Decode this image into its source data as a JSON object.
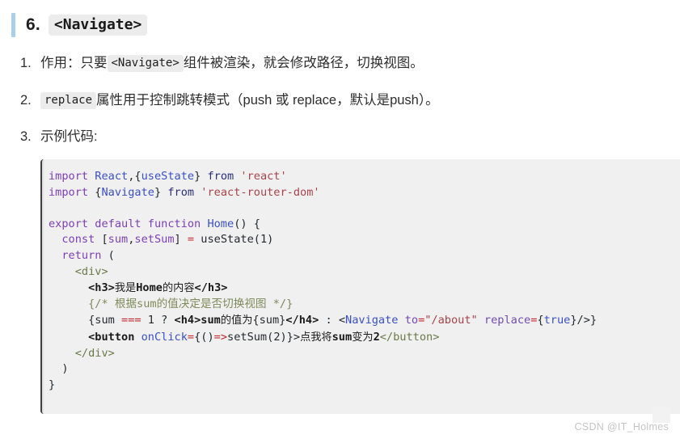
{
  "heading": {
    "number": "6.",
    "code": "<Navigate>"
  },
  "list": [
    {
      "marker": "1.",
      "before": "作用：只要",
      "code": "<Navigate>",
      "after": "组件被渲染，就会修改路径，切换视图。"
    },
    {
      "marker": "2.",
      "before": "",
      "code": "replace",
      "after": "属性用于控制跳转模式（push 或 replace，默认是push）。"
    },
    {
      "marker": "3.",
      "before": "示例代码:",
      "code": "",
      "after": ""
    }
  ],
  "code_block": {
    "language": "jsx",
    "lines": [
      {
        "tokens": [
          {
            "t": "import",
            "c": "tok-kw"
          },
          {
            "t": " ",
            "c": "tok-plain"
          },
          {
            "t": "React",
            "c": "tok-fn"
          },
          {
            "t": ",{",
            "c": "tok-punc"
          },
          {
            "t": "useState",
            "c": "tok-fn"
          },
          {
            "t": "} ",
            "c": "tok-punc"
          },
          {
            "t": "from",
            "c": "tok-from"
          },
          {
            "t": " ",
            "c": "tok-plain"
          },
          {
            "t": "'react'",
            "c": "tok-str"
          }
        ]
      },
      {
        "tokens": [
          {
            "t": "import",
            "c": "tok-kw"
          },
          {
            "t": " {",
            "c": "tok-punc"
          },
          {
            "t": "Navigate",
            "c": "tok-fn"
          },
          {
            "t": "} ",
            "c": "tok-punc"
          },
          {
            "t": "from",
            "c": "tok-from"
          },
          {
            "t": " ",
            "c": "tok-plain"
          },
          {
            "t": "'react-router-dom'",
            "c": "tok-str"
          }
        ]
      },
      {
        "tokens": []
      },
      {
        "tokens": [
          {
            "t": "export default function",
            "c": "tok-kw"
          },
          {
            "t": " ",
            "c": "tok-plain"
          },
          {
            "t": "Home",
            "c": "tok-fn"
          },
          {
            "t": "() {",
            "c": "tok-punc"
          }
        ]
      },
      {
        "tokens": [
          {
            "t": "  ",
            "c": "tok-plain"
          },
          {
            "t": "const",
            "c": "tok-kw"
          },
          {
            "t": " [",
            "c": "tok-punc"
          },
          {
            "t": "sum",
            "c": "tok-var"
          },
          {
            "t": ",",
            "c": "tok-punc"
          },
          {
            "t": "setSum",
            "c": "tok-var"
          },
          {
            "t": "] ",
            "c": "tok-punc"
          },
          {
            "t": "=",
            "c": "tok-op"
          },
          {
            "t": " useState(",
            "c": "tok-plain"
          },
          {
            "t": "1",
            "c": "tok-num"
          },
          {
            "t": ")",
            "c": "tok-punc"
          }
        ]
      },
      {
        "tokens": [
          {
            "t": "  ",
            "c": "tok-plain"
          },
          {
            "t": "return",
            "c": "tok-kw"
          },
          {
            "t": " (",
            "c": "tok-punc"
          }
        ]
      },
      {
        "tokens": [
          {
            "t": "    ",
            "c": "tok-plain"
          },
          {
            "t": "<div>",
            "c": "tok-tag"
          }
        ]
      },
      {
        "tokens": [
          {
            "t": "      ",
            "c": "tok-plain"
          },
          {
            "t": "<h3>",
            "c": "tok-tagname"
          },
          {
            "t": "我是",
            "c": "tok-cn"
          },
          {
            "t": "Home",
            "c": "tok-tagname"
          },
          {
            "t": "的内容",
            "c": "tok-cn"
          },
          {
            "t": "</h3>",
            "c": "tok-tagname"
          }
        ]
      },
      {
        "tokens": [
          {
            "t": "      ",
            "c": "tok-plain"
          },
          {
            "t": "{/* 根据sum的值决定是否切换视图 */}",
            "c": "tok-comment"
          }
        ]
      },
      {
        "tokens": [
          {
            "t": "      ",
            "c": "tok-plain"
          },
          {
            "t": "{",
            "c": "tok-punc"
          },
          {
            "t": "sum",
            "c": "tok-plain"
          },
          {
            "t": " ",
            "c": "tok-plain"
          },
          {
            "t": "===",
            "c": "tok-op"
          },
          {
            "t": " ",
            "c": "tok-plain"
          },
          {
            "t": "1",
            "c": "tok-num"
          },
          {
            "t": " ? ",
            "c": "tok-punc"
          },
          {
            "t": "<h4>",
            "c": "tok-tagname"
          },
          {
            "t": "sum",
            "c": "tok-tagname"
          },
          {
            "t": "的值为",
            "c": "tok-cn"
          },
          {
            "t": "{sum}",
            "c": "tok-punc"
          },
          {
            "t": "</h4>",
            "c": "tok-tagname"
          },
          {
            "t": " : ",
            "c": "tok-punc"
          },
          {
            "t": "<",
            "c": "tok-punc"
          },
          {
            "t": "Navigate",
            "c": "tok-fn"
          },
          {
            "t": " ",
            "c": "tok-plain"
          },
          {
            "t": "to",
            "c": "tok-attr"
          },
          {
            "t": "=",
            "c": "tok-op"
          },
          {
            "t": "\"/about\"",
            "c": "tok-str"
          },
          {
            "t": " ",
            "c": "tok-plain"
          },
          {
            "t": "replace",
            "c": "tok-attr"
          },
          {
            "t": "=",
            "c": "tok-op"
          },
          {
            "t": "{",
            "c": "tok-punc"
          },
          {
            "t": "true",
            "c": "tok-bool"
          },
          {
            "t": "}/>}",
            "c": "tok-punc"
          }
        ]
      },
      {
        "tokens": [
          {
            "t": "      ",
            "c": "tok-plain"
          },
          {
            "t": "<button",
            "c": "tok-tagname"
          },
          {
            "t": " ",
            "c": "tok-plain"
          },
          {
            "t": "onClick",
            "c": "tok-fn"
          },
          {
            "t": "=",
            "c": "tok-op"
          },
          {
            "t": "{()",
            "c": "tok-punc"
          },
          {
            "t": "=>",
            "c": "tok-op"
          },
          {
            "t": "setSum(",
            "c": "tok-plain"
          },
          {
            "t": "2",
            "c": "tok-num"
          },
          {
            "t": ")}>",
            "c": "tok-punc"
          },
          {
            "t": "点我将",
            "c": "tok-cn"
          },
          {
            "t": "sum",
            "c": "tok-tagname"
          },
          {
            "t": "变为",
            "c": "tok-cn"
          },
          {
            "t": "2",
            "c": "tok-tagname"
          },
          {
            "t": "</button>",
            "c": "tok-tag"
          }
        ]
      },
      {
        "tokens": [
          {
            "t": "    ",
            "c": "tok-plain"
          },
          {
            "t": "</div>",
            "c": "tok-tag"
          }
        ]
      },
      {
        "tokens": [
          {
            "t": "  ",
            "c": "tok-plain"
          },
          {
            "t": ")",
            "c": "tok-punc"
          }
        ]
      },
      {
        "tokens": [
          {
            "t": "}",
            "c": "tok-punc"
          }
        ]
      }
    ]
  },
  "watermark": {
    "text": "CSDN @IT_Holmes"
  }
}
